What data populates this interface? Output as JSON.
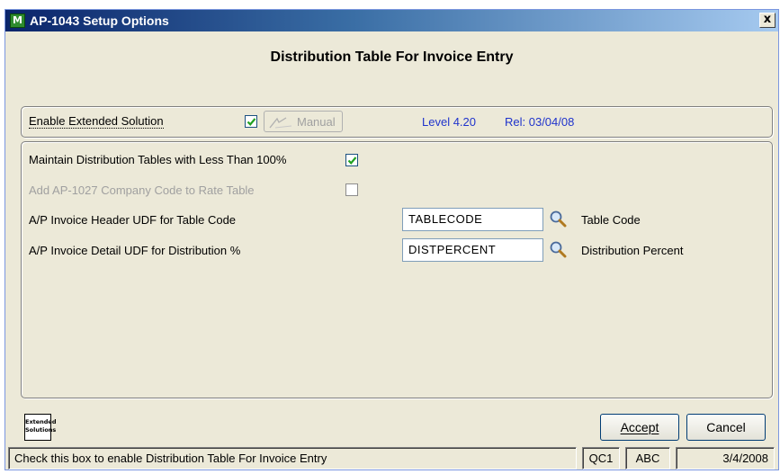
{
  "window": {
    "title": "AP-1043 Setup Options",
    "app_icon_glyph": "M",
    "close_glyph": "x"
  },
  "heading": "Distribution Table For Invoice Entry",
  "enable": {
    "label": "Enable Extended Solution",
    "checked": true,
    "manual_label": "Manual",
    "level": "Level 4.20",
    "rel": "Rel: 03/04/08"
  },
  "options": {
    "maintain_label": "Maintain Distribution Tables with Less Than 100%",
    "maintain_checked": true,
    "add_company_label": "Add AP-1027 Company Code to Rate Table",
    "add_company_checked": false,
    "header_udf_label": "A/P Invoice Header UDF for Table Code",
    "header_udf_value": "TABLECODE",
    "header_udf_desc": "Table Code",
    "detail_udf_label": "A/P Invoice Detail UDF for Distribution %",
    "detail_udf_value": "DISTPERCENT",
    "detail_udf_desc": "Distribution Percent"
  },
  "logo": {
    "line1": "Extended",
    "line2": "Solutions"
  },
  "buttons": {
    "accept": "Accept",
    "cancel": "Cancel"
  },
  "statusbar": {
    "message": "Check this box to enable Distribution Table For Invoice Entry",
    "company": "QC1",
    "user": "ABC",
    "date": "3/4/2008"
  },
  "colors": {
    "link_blue": "#1f33cc",
    "check_green": "#21a121",
    "dialog_bg": "#ece9d8"
  }
}
